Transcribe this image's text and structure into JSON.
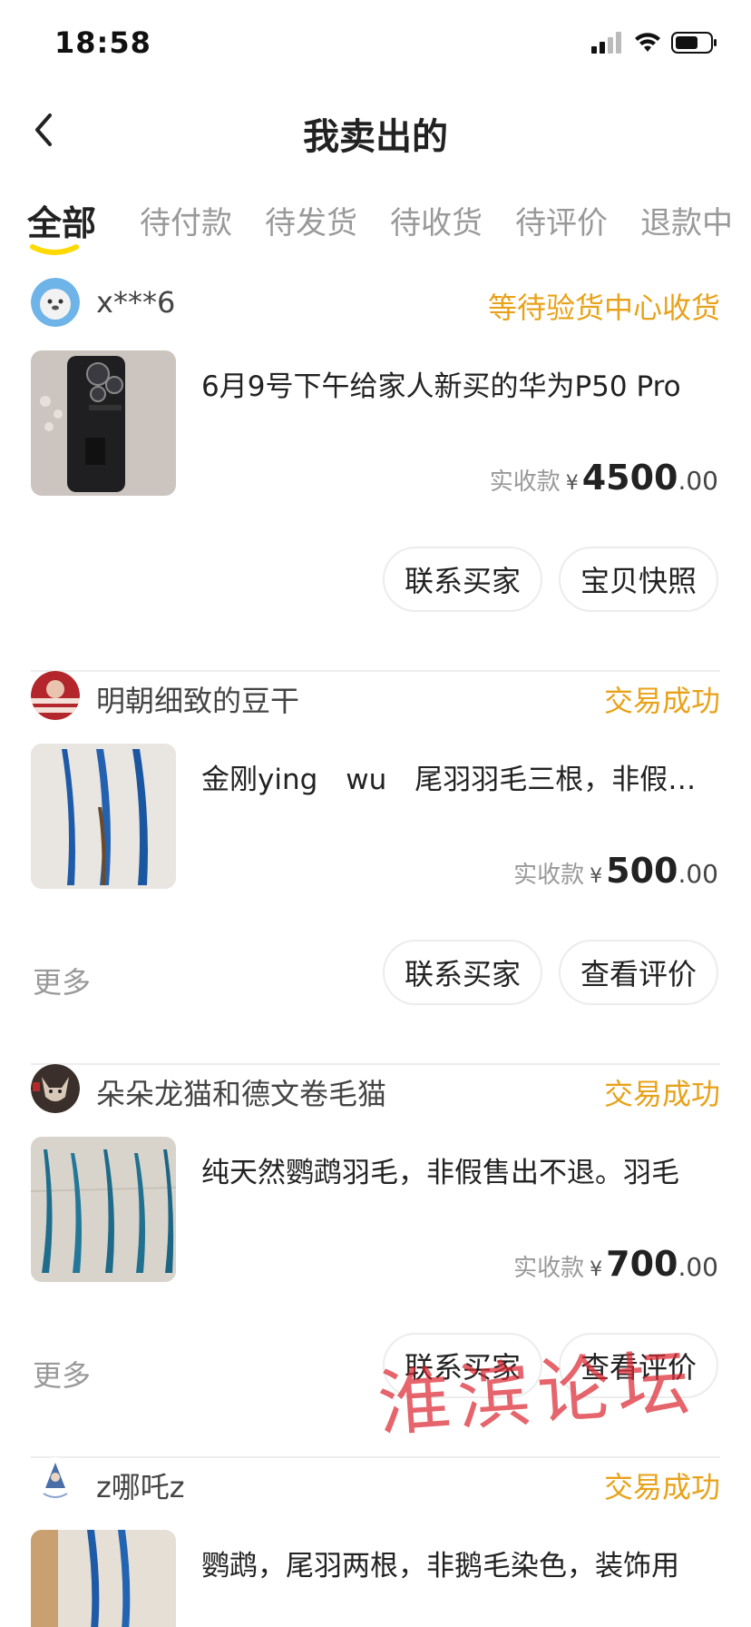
{
  "status_bar": {
    "time": "18:58"
  },
  "header": {
    "title": "我卖出的"
  },
  "tabs": [
    {
      "label": "全部",
      "active": true
    },
    {
      "label": "待付款"
    },
    {
      "label": "待发货"
    },
    {
      "label": "待收货"
    },
    {
      "label": "待评价"
    },
    {
      "label": "退款中"
    }
  ],
  "orders": [
    {
      "buyer": "x***6",
      "status": "等待验货中心收货",
      "title": "6月9号下午给家人新买的华为P50 Pro",
      "price_label": "实收款",
      "currency": "¥",
      "price_int": "4500",
      "price_dec": ".00",
      "more": "",
      "buttons": [
        "联系买家",
        "宝贝快照"
      ]
    },
    {
      "buyer": "明朝细致的豆干",
      "status": "交易成功",
      "title": "金刚ying　wu　尾羽羽毛三根，非假售出不退",
      "price_label": "实收款",
      "currency": "¥",
      "price_int": "500",
      "price_dec": ".00",
      "more": "更多",
      "buttons": [
        "联系买家",
        "查看评价"
      ]
    },
    {
      "buyer": "朵朵龙猫和德文卷毛猫",
      "status": "交易成功",
      "title": "纯天然鹦鹉羽毛，非假售出不退。羽毛",
      "price_label": "实收款",
      "currency": "¥",
      "price_int": "700",
      "price_dec": ".00",
      "more": "更多",
      "buttons": [
        "联系买家",
        "查看评价"
      ]
    },
    {
      "buyer": "z哪吒z",
      "status": "交易成功",
      "title": "鹦鹉，尾羽两根，非鹅毛染色，装饰用",
      "price_label": "",
      "currency": "",
      "price_int": "",
      "price_dec": "",
      "more": "",
      "buttons": []
    }
  ],
  "watermark": "淮滨论坛",
  "colors": {
    "accent": "#e8a21a",
    "tab_indicator": "#ffd900",
    "watermark": "#dc2832"
  }
}
